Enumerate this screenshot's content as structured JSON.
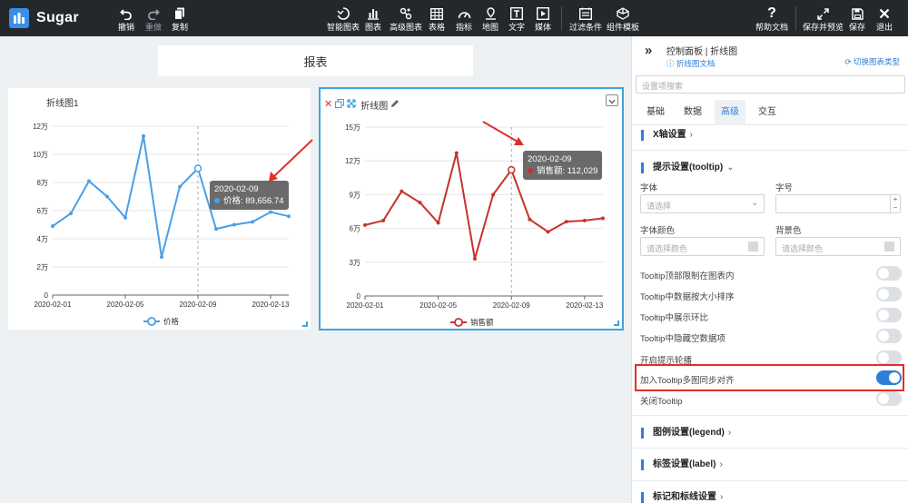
{
  "app": {
    "name": "Sugar"
  },
  "toolbar": {
    "left": [
      {
        "label": "撤销",
        "icon": "undo-icon"
      },
      {
        "label": "重做",
        "icon": "redo-icon"
      },
      {
        "label": "复制",
        "icon": "copy-icon"
      }
    ],
    "center": [
      {
        "label": "智能图表",
        "icon": "smart-chart-icon"
      },
      {
        "label": "图表",
        "icon": "chart-icon"
      },
      {
        "label": "高级图表",
        "icon": "advanced-chart-icon"
      },
      {
        "label": "表格",
        "icon": "table-icon"
      },
      {
        "label": "指标",
        "icon": "gauge-icon"
      },
      {
        "label": "地图",
        "icon": "map-icon"
      },
      {
        "label": "文字",
        "icon": "text-icon"
      },
      {
        "label": "媒体",
        "icon": "media-icon"
      },
      {
        "label": "过滤条件",
        "icon": "filter-icon"
      },
      {
        "label": "组件模板",
        "icon": "template-icon"
      }
    ],
    "right": [
      {
        "label": "帮助文档",
        "icon": "help-icon"
      },
      {
        "label": "保存并预览",
        "icon": "expand-icon"
      },
      {
        "label": "保存",
        "icon": "save-icon"
      },
      {
        "label": "退出",
        "icon": "close-icon"
      }
    ]
  },
  "report": {
    "title": "报表"
  },
  "chart1": {
    "title": "折线图1",
    "tooltip": {
      "date": "2020-02-09",
      "label": "价格: 89,656.74"
    }
  },
  "chart2": {
    "title": "折线图",
    "tooltip": {
      "date": "2020-02-09",
      "label": "销售额: 112,029"
    }
  },
  "chart_data": [
    {
      "type": "line",
      "title": "折线图1",
      "x_ticks": [
        "2020-02-01",
        "2020-02-05",
        "2020-02-09",
        "2020-02-13"
      ],
      "y_ticks": [
        "0",
        "2万",
        "4万",
        "6万",
        "8万",
        "10万",
        "12万"
      ],
      "ylim": [
        0,
        120000
      ],
      "series": [
        {
          "name": "价格",
          "color": "#4a9fe8",
          "values": [
            49000,
            58000,
            81000,
            70000,
            55000,
            113000,
            27000,
            77000,
            90000,
            47000,
            50000,
            52000,
            59000,
            56000
          ]
        }
      ],
      "legend": "bottom-center",
      "grid": "horizontal"
    },
    {
      "type": "line",
      "title": "折线图",
      "x_ticks": [
        "2020-02-01",
        "2020-02-05",
        "2020-02-09",
        "2020-02-13"
      ],
      "y_ticks": [
        "0",
        "3万",
        "6万",
        "9万",
        "12万",
        "15万"
      ],
      "ylim": [
        0,
        150000
      ],
      "series": [
        {
          "name": "销售额",
          "color": "#c8312b",
          "values": [
            63000,
            67000,
            93000,
            83000,
            65000,
            127000,
            33000,
            90000,
            112000,
            68000,
            57000,
            66000,
            67000,
            69000
          ]
        }
      ],
      "legend": "bottom-center",
      "grid": "horizontal"
    }
  ],
  "panel": {
    "breadcrumb": "控制面板 | 折线图",
    "doc_link": "折线图文档",
    "switch_type": "切换图表类型",
    "search_placeholder": "设置项搜索",
    "tabs": [
      "基础",
      "数据",
      "高级",
      "交互"
    ],
    "sections": {
      "xaxis": "X轴设置",
      "tooltip": "提示设置(tooltip)",
      "legend": "图例设置(legend)",
      "label": "标签设置(label)",
      "marker": "标记和标线设置"
    },
    "font_label": "字体",
    "font_placeholder": "请选择",
    "size_label": "字号",
    "font_color_label": "字体颜色",
    "bg_color_label": "背景色",
    "color_placeholder": "请选择颜色",
    "toggles": [
      {
        "label": "Tooltip顶部限制在图表内",
        "on": false
      },
      {
        "label": "Tooltip中数据按大小排序",
        "on": false
      },
      {
        "label": "Tooltip中展示环比",
        "on": false
      },
      {
        "label": "Tooltip中隐藏空数据项",
        "on": false
      },
      {
        "label": "开启提示轮播",
        "on": false
      },
      {
        "label": "加入Tooltip多图同步对齐",
        "on": true
      },
      {
        "label": "关闭Tooltip",
        "on": false
      }
    ]
  }
}
